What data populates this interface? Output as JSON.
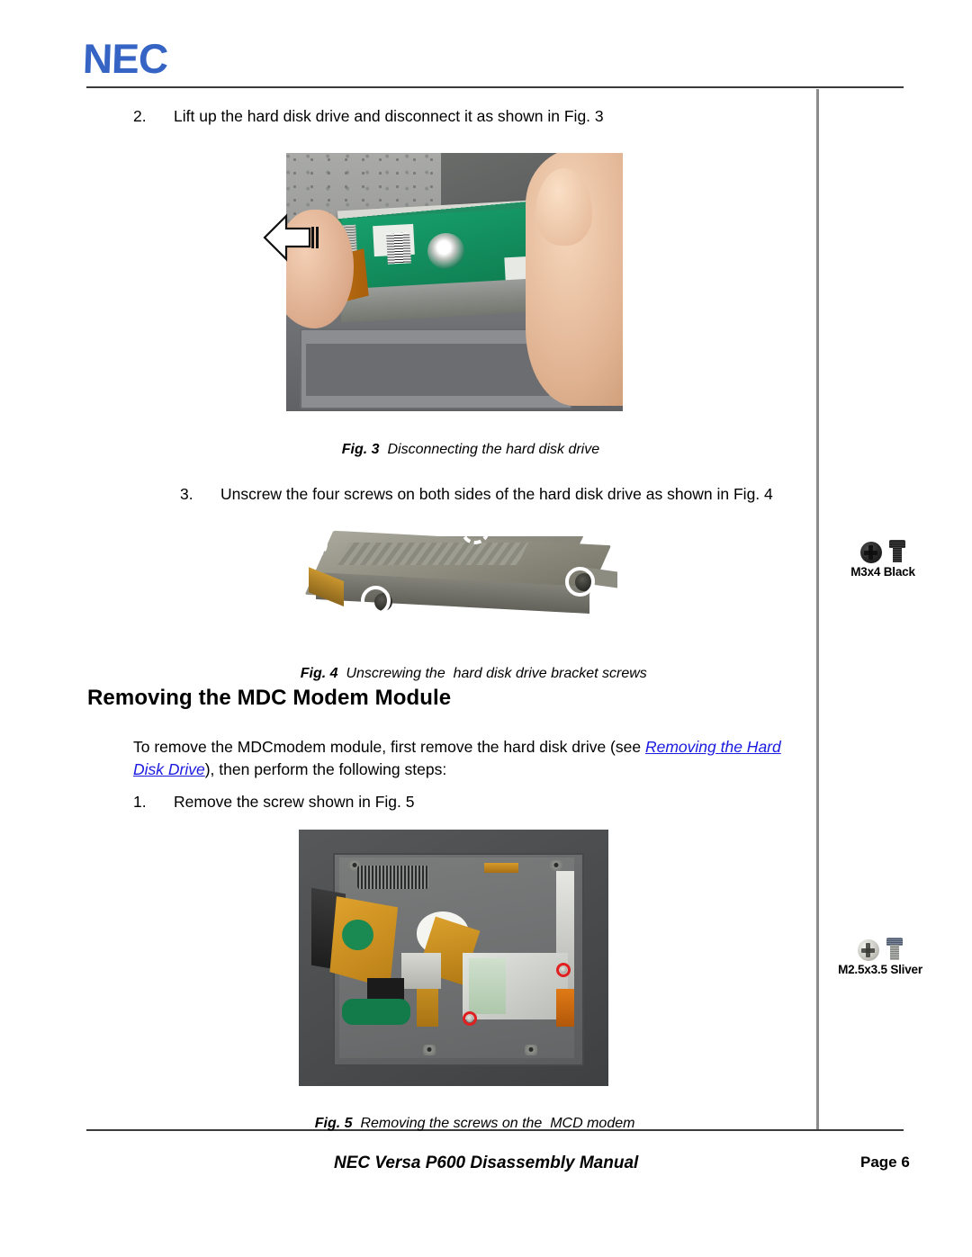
{
  "document": {
    "logo_text": "NEC",
    "logo_color": "#3664c4",
    "heading": "Removing the MDC Modem Module"
  },
  "steps": {
    "step2": {
      "number": "2.",
      "text": "Lift up the hard disk drive and disconnect it as shown in Fig. 3"
    },
    "step3": {
      "number": "3.",
      "text": "Unscrew the four screws on both sides of the hard disk drive as shown in Fig. 4"
    },
    "step1b": {
      "number": "1.",
      "text": "Remove the screw shown in Fig. 5"
    }
  },
  "paragraph": {
    "before_link": "To remove the MDCmodem module, first remove the hard disk drive (see ",
    "link_text": "Removing the Hard Disk Drive",
    "link_color": "#1a1ae0",
    "after_link": "), then perform the following steps:"
  },
  "figures": {
    "fig3": {
      "label": "Fig. 3",
      "caption": "  Disconnecting the hard disk drive"
    },
    "fig4": {
      "label": "Fig. 4",
      "caption": "  Unscrewing the  hard disk drive bracket screws"
    },
    "fig5": {
      "label": "Fig. 5",
      "caption": "  Removing the screws on the  MCD modem"
    }
  },
  "margin_notes": {
    "screw_black": {
      "label": "M3x4 Black"
    },
    "screw_silver": {
      "label": "M2.5x3.5 Sliver"
    }
  },
  "footer": {
    "title": "NEC Versa P600 Disassembly Manual",
    "page": "Page 6"
  }
}
